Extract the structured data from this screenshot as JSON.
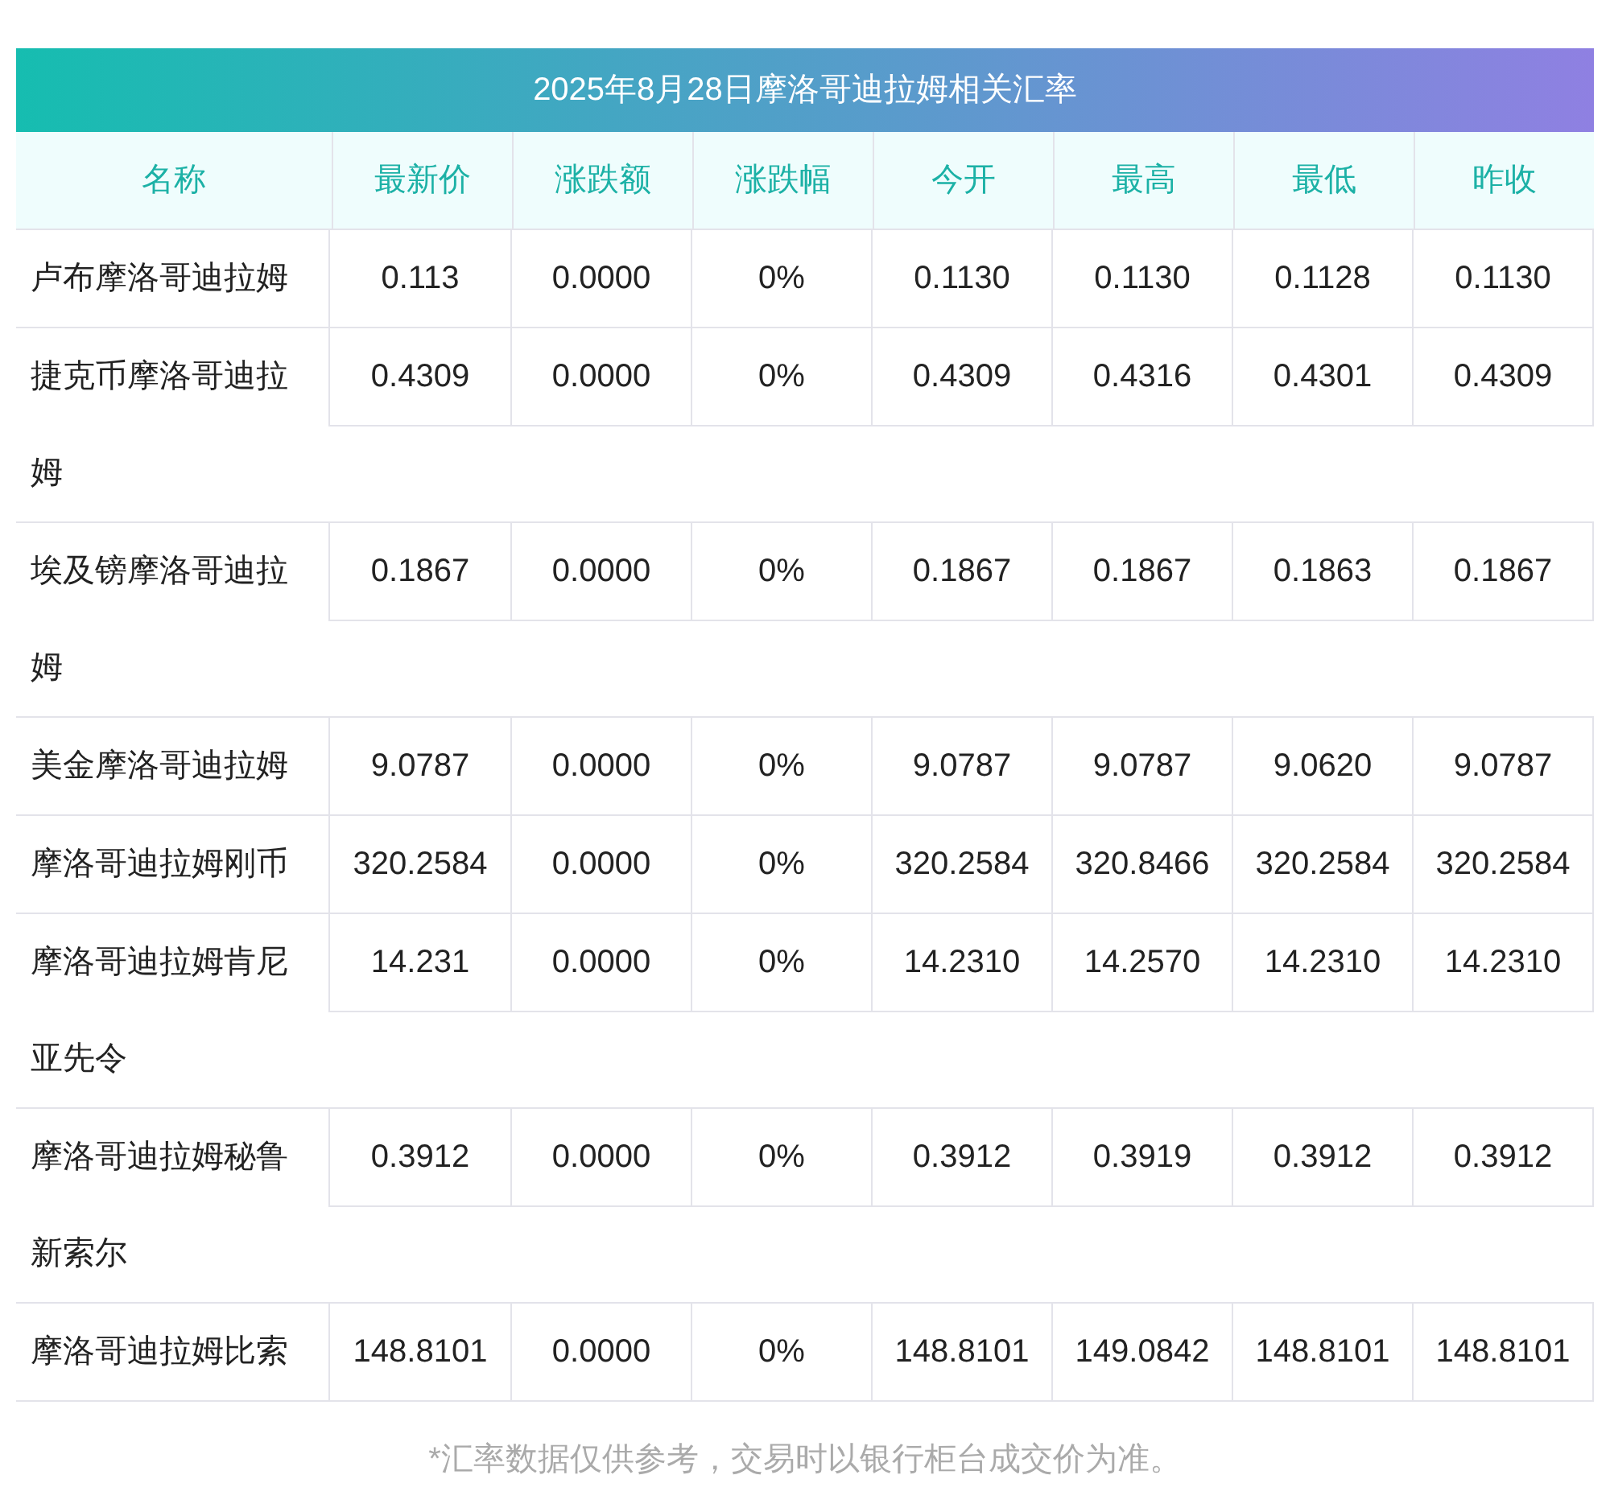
{
  "title": "2025年8月28日摩洛哥迪拉姆相关汇率",
  "columns": [
    "名称",
    "最新价",
    "涨跌额",
    "涨跌幅",
    "今开",
    "最高",
    "最低",
    "昨收"
  ],
  "rows": [
    {
      "name": "卢布摩洛哥迪拉姆",
      "values": [
        "0.113",
        "0.0000",
        "0%",
        "0.1130",
        "0.1130",
        "0.1128",
        "0.1130"
      ]
    },
    {
      "name": "捷克币摩洛哥迪拉姆",
      "values": [
        "0.4309",
        "0.0000",
        "0%",
        "0.4309",
        "0.4316",
        "0.4301",
        "0.4309"
      ]
    },
    {
      "name": "埃及镑摩洛哥迪拉姆",
      "values": [
        "0.1867",
        "0.0000",
        "0%",
        "0.1867",
        "0.1867",
        "0.1863",
        "0.1867"
      ]
    },
    {
      "name": "美金摩洛哥迪拉姆",
      "values": [
        "9.0787",
        "0.0000",
        "0%",
        "9.0787",
        "9.0787",
        "9.0620",
        "9.0787"
      ]
    },
    {
      "name": "摩洛哥迪拉姆刚币",
      "values": [
        "320.2584",
        "0.0000",
        "0%",
        "320.2584",
        "320.8466",
        "320.2584",
        "320.2584"
      ]
    },
    {
      "name": "摩洛哥迪拉姆肯尼亚先令",
      "values": [
        "14.231",
        "0.0000",
        "0%",
        "14.2310",
        "14.2570",
        "14.2310",
        "14.2310"
      ]
    },
    {
      "name": "摩洛哥迪拉姆秘鲁新索尔",
      "values": [
        "0.3912",
        "0.0000",
        "0%",
        "0.3912",
        "0.3919",
        "0.3912",
        "0.3912"
      ]
    },
    {
      "name": "摩洛哥迪拉姆比索",
      "values": [
        "148.8101",
        "0.0000",
        "0%",
        "148.8101",
        "149.0842",
        "148.8101",
        "148.8101"
      ]
    }
  ],
  "note": "*汇率数据仅供参考，交易时以银行柜台成交价为准。"
}
